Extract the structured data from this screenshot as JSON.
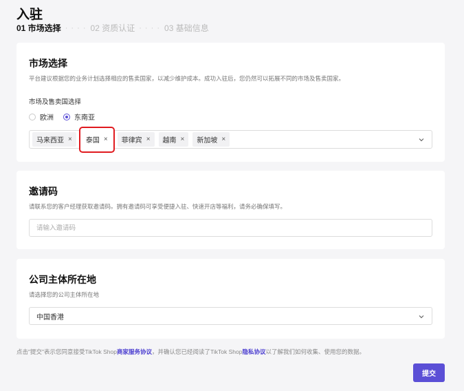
{
  "page": {
    "title": "入驻"
  },
  "steps": [
    {
      "label": "01 市场选择",
      "active": true
    },
    {
      "label": "02 资质认证",
      "active": false
    },
    {
      "label": "03 基础信息",
      "active": false
    }
  ],
  "market": {
    "title": "市场选择",
    "description": "平台建议根据您的业务计划选择相应的售卖国家，以减少维护成本。成功入驻后，您仍然可以拓展不同的市场及售卖国家。",
    "field_label": "市场及售卖国选择",
    "regions": [
      {
        "label": "欧洲",
        "checked": false
      },
      {
        "label": "东南亚",
        "checked": true
      }
    ],
    "selected_countries": [
      "马来西亚",
      "泰国",
      "菲律宾",
      "越南",
      "新加坡"
    ],
    "highlighted_country": "泰国"
  },
  "invite": {
    "title": "邀请码",
    "description": "请联系您的客户经理获取邀请码。拥有邀请码可享受便捷入驻、快速开店等福利，请务必确保填写。",
    "input_placeholder": "请输入邀请码",
    "input_value": ""
  },
  "company": {
    "title": "公司主体所在地",
    "description": "请选择您的公司主体所在地",
    "selected_value": "中国香港"
  },
  "footer": {
    "prefix": "点击\"提交\"表示您同意接受TikTok Shop",
    "link1": "商家服务协议",
    "middle": "，并确认您已经阅读了TikTok Shop",
    "link2": "隐私协议",
    "suffix": "以了解我们如何收集、使用您的数据。"
  },
  "submit_label": "提交",
  "colors": {
    "accent": "#5b4fd6",
    "highlight_box": "#e0191e"
  }
}
